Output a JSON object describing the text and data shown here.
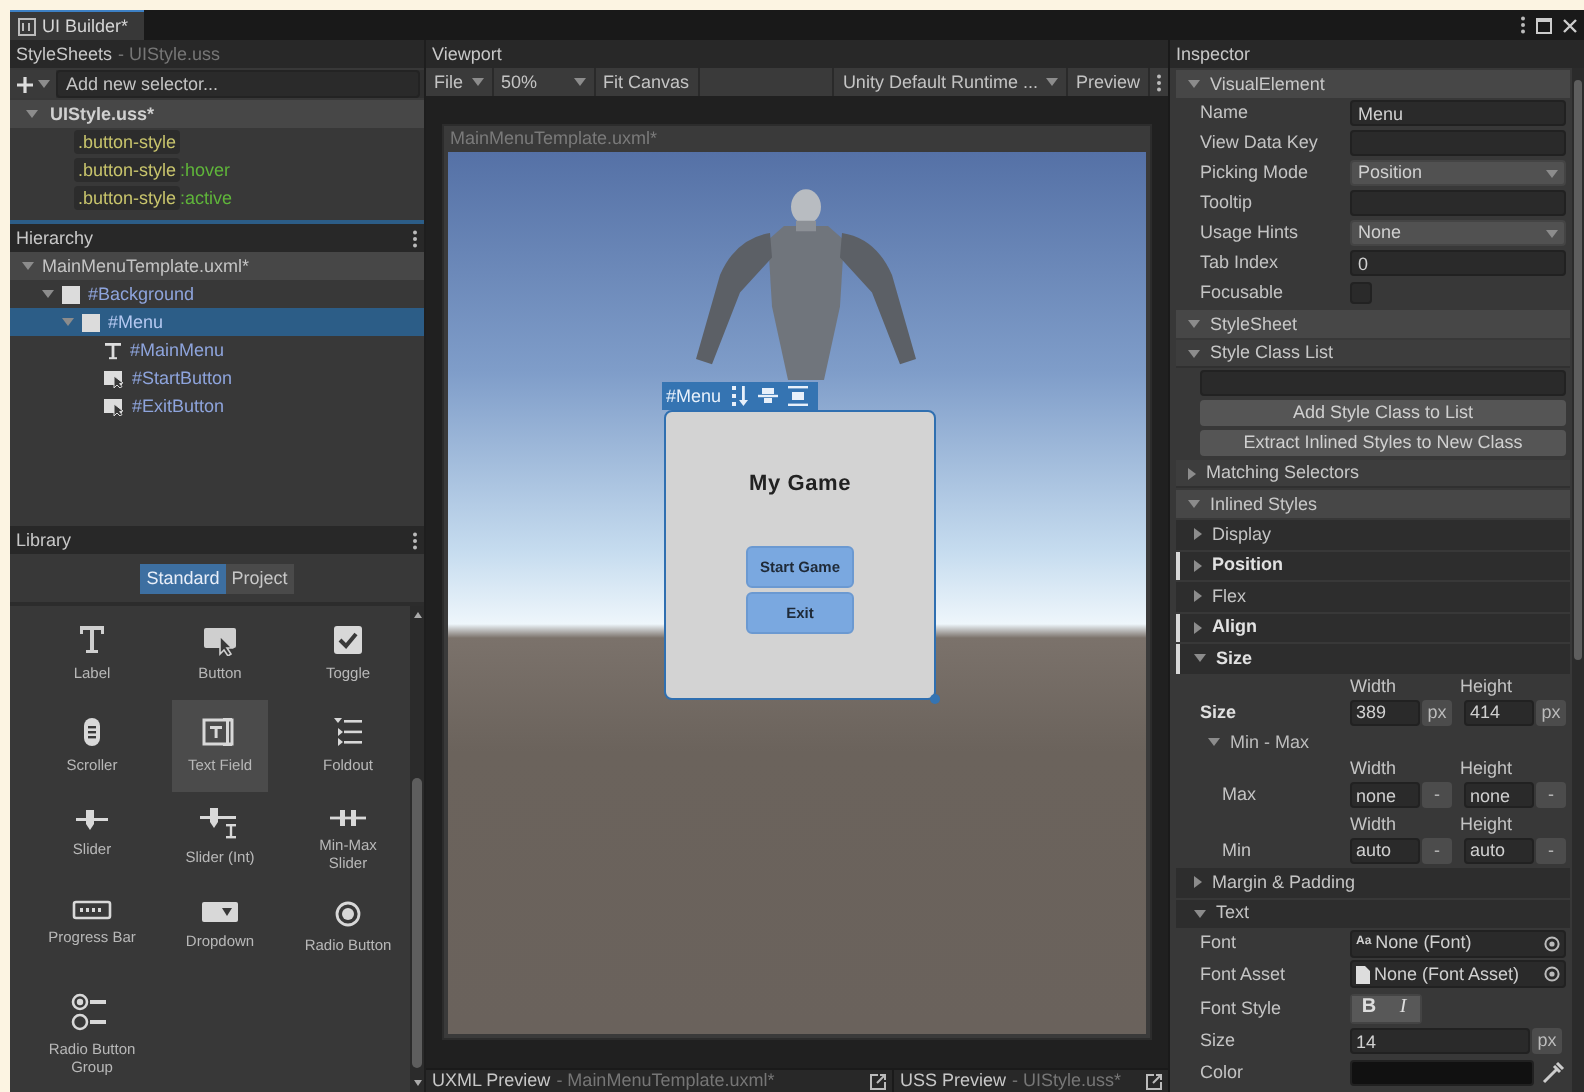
{
  "window": {
    "tab_title": "UI Builder*"
  },
  "stylesheets": {
    "title": "StyleSheets",
    "subtitle": "- UIStyle.uss",
    "selector_placeholder": "Add new selector...",
    "file": "UIStyle.uss*",
    "expanded": true,
    "selectors": [
      {
        "name": ".button-style"
      },
      {
        "name": ".button-style",
        "pseudo": ":hover"
      },
      {
        "name": ".button-style",
        "pseudo": ":active"
      }
    ]
  },
  "hierarchy": {
    "title": "Hierarchy",
    "items": [
      {
        "label": "MainMenuTemplate.uxml*",
        "kind": "document",
        "expanded": true,
        "selected": false,
        "children": [
          {
            "label": "#Background",
            "kind": "element",
            "expanded": true,
            "selected": false,
            "children": [
              {
                "label": "#Menu",
                "kind": "element",
                "expanded": true,
                "selected": true,
                "children": [
                  {
                    "label": "#MainMenu",
                    "kind": "label",
                    "selected": false
                  },
                  {
                    "label": "#StartButton",
                    "kind": "button",
                    "selected": false
                  },
                  {
                    "label": "#ExitButton",
                    "kind": "button",
                    "selected": false
                  }
                ]
              }
            ]
          }
        ]
      }
    ]
  },
  "library": {
    "title": "Library",
    "tabs": [
      {
        "label": "Standard",
        "selected": true
      },
      {
        "label": "Project",
        "selected": false
      }
    ],
    "items": [
      {
        "label": "Label",
        "kind": "label",
        "selected": false
      },
      {
        "label": "Button",
        "kind": "button",
        "selected": false
      },
      {
        "label": "Toggle",
        "kind": "toggle",
        "selected": false
      },
      {
        "label": "Scroller",
        "kind": "scroller",
        "selected": false
      },
      {
        "label": "Text Field",
        "kind": "textfield",
        "selected": true
      },
      {
        "label": "Foldout",
        "kind": "foldout",
        "selected": false
      },
      {
        "label": "Slider",
        "kind": "slider",
        "selected": false
      },
      {
        "label": "Slider (Int)",
        "kind": "sliderint",
        "selected": false
      },
      {
        "label": "Min-Max Slider",
        "kind": "minmax",
        "selected": false
      },
      {
        "label": "Progress Bar",
        "kind": "progressbar",
        "selected": false
      },
      {
        "label": "Dropdown",
        "kind": "dropdown",
        "selected": false
      },
      {
        "label": "Radio Button",
        "kind": "radio",
        "selected": false
      },
      {
        "label": "Radio Button Group",
        "kind": "radiogroup",
        "selected": false
      }
    ]
  },
  "viewport": {
    "title": "Viewport",
    "toolbar": [
      {
        "label": "File",
        "kind": "menu"
      },
      {
        "label": "50%",
        "kind": "menu"
      },
      {
        "label": "Fit Canvas",
        "kind": "button"
      },
      {
        "label": "Unity Default Runtime ...",
        "kind": "menu"
      },
      {
        "label": "Preview",
        "kind": "button"
      }
    ],
    "document_title": "MainMenuTemplate.uxml*",
    "selection_label": "#Menu",
    "menu_title": "My Game",
    "menu_buttons": [
      "Start Game",
      "Exit"
    ]
  },
  "previews": [
    {
      "title": "UXML Preview",
      "file": "- MainMenuTemplate.uxml*"
    },
    {
      "title": "USS Preview",
      "file": "- UIStyle.uss*"
    }
  ],
  "inspector": {
    "title": "Inspector",
    "sections": [
      {
        "kind": "section",
        "label": "VisualElement",
        "expanded": true,
        "children": [
          {
            "kind": "text",
            "label": "Name",
            "value": "Menu"
          },
          {
            "kind": "text",
            "label": "View Data Key"
          },
          {
            "kind": "dropdown",
            "label": "Picking Mode",
            "value": "Position"
          },
          {
            "kind": "text",
            "label": "Tooltip"
          },
          {
            "kind": "dropdown",
            "label": "Usage Hints",
            "value": "None"
          },
          {
            "kind": "text",
            "label": "Tab Index",
            "value": "0"
          },
          {
            "kind": "checkbox",
            "label": "Focusable",
            "checked": false
          }
        ]
      },
      {
        "kind": "section",
        "label": "StyleSheet",
        "expanded": true,
        "children": [
          {
            "kind": "subsection",
            "label": "Style Class List",
            "expanded": true,
            "children": [
              {
                "kind": "blank"
              },
              {
                "kind": "button",
                "label": "Add Style Class to List"
              },
              {
                "kind": "button",
                "label": "Extract Inlined Styles to New Class"
              }
            ]
          },
          {
            "kind": "subsection",
            "label": "Matching Selectors",
            "expanded": false
          }
        ]
      },
      {
        "kind": "section",
        "label": "Inlined Styles",
        "expanded": true,
        "children": [
          {
            "kind": "group",
            "label": "Display",
            "expanded": false,
            "overridden": false
          },
          {
            "kind": "group",
            "label": "Position",
            "expanded": false,
            "overridden": true
          },
          {
            "kind": "group",
            "label": "Flex",
            "expanded": false,
            "overridden": false
          },
          {
            "kind": "group",
            "label": "Align",
            "expanded": false,
            "overridden": true
          },
          {
            "kind": "group",
            "label": "Size",
            "expanded": true,
            "overridden": true,
            "children": [
              {
                "kind": "columns",
                "columns": [
                  "Width",
                  "Height"
                ]
              },
              {
                "kind": "size",
                "label": "Size",
                "overridden": true,
                "fields": [
                  {
                    "value": "389",
                    "unit": "px"
                  },
                  {
                    "value": "414",
                    "unit": "px"
                  }
                ]
              },
              {
                "kind": "foldout",
                "label": "Min - Max",
                "expanded": true,
                "children": [
                  {
                    "kind": "columns",
                    "columns": [
                      "Width",
                      "Height"
                    ]
                  },
                  {
                    "kind": "size",
                    "label": "Max",
                    "overridden": false,
                    "fields": [
                      {
                        "value": "none",
                        "unit": "-"
                      },
                      {
                        "value": "none",
                        "unit": "-"
                      }
                    ]
                  },
                  {
                    "kind": "columns",
                    "columns": [
                      "Width",
                      "Height"
                    ]
                  },
                  {
                    "kind": "size",
                    "label": "Min",
                    "overridden": false,
                    "fields": [
                      {
                        "value": "auto",
                        "unit": "-"
                      },
                      {
                        "value": "auto",
                        "unit": "-"
                      }
                    ]
                  }
                ]
              }
            ]
          },
          {
            "kind": "group",
            "label": "Margin & Padding",
            "expanded": false,
            "overridden": false
          },
          {
            "kind": "group",
            "label": "Text",
            "expanded": true,
            "overridden": false,
            "children": [
              {
                "kind": "font",
                "label": "Font",
                "glyph": "Aa",
                "value": "None (Font)"
              },
              {
                "kind": "asset",
                "label": "Font Asset",
                "value": "None (Font Asset)"
              },
              {
                "kind": "toggles",
                "label": "Font Style",
                "buttons": [
                  {
                    "label": "B",
                    "selected": false
                  },
                  {
                    "label": "I",
                    "selected": false
                  }
                ]
              },
              {
                "kind": "unit",
                "label": "Size",
                "value": "14",
                "unit": "px"
              },
              {
                "kind": "color",
                "label": "Color"
              }
            ]
          }
        ]
      }
    ]
  }
}
